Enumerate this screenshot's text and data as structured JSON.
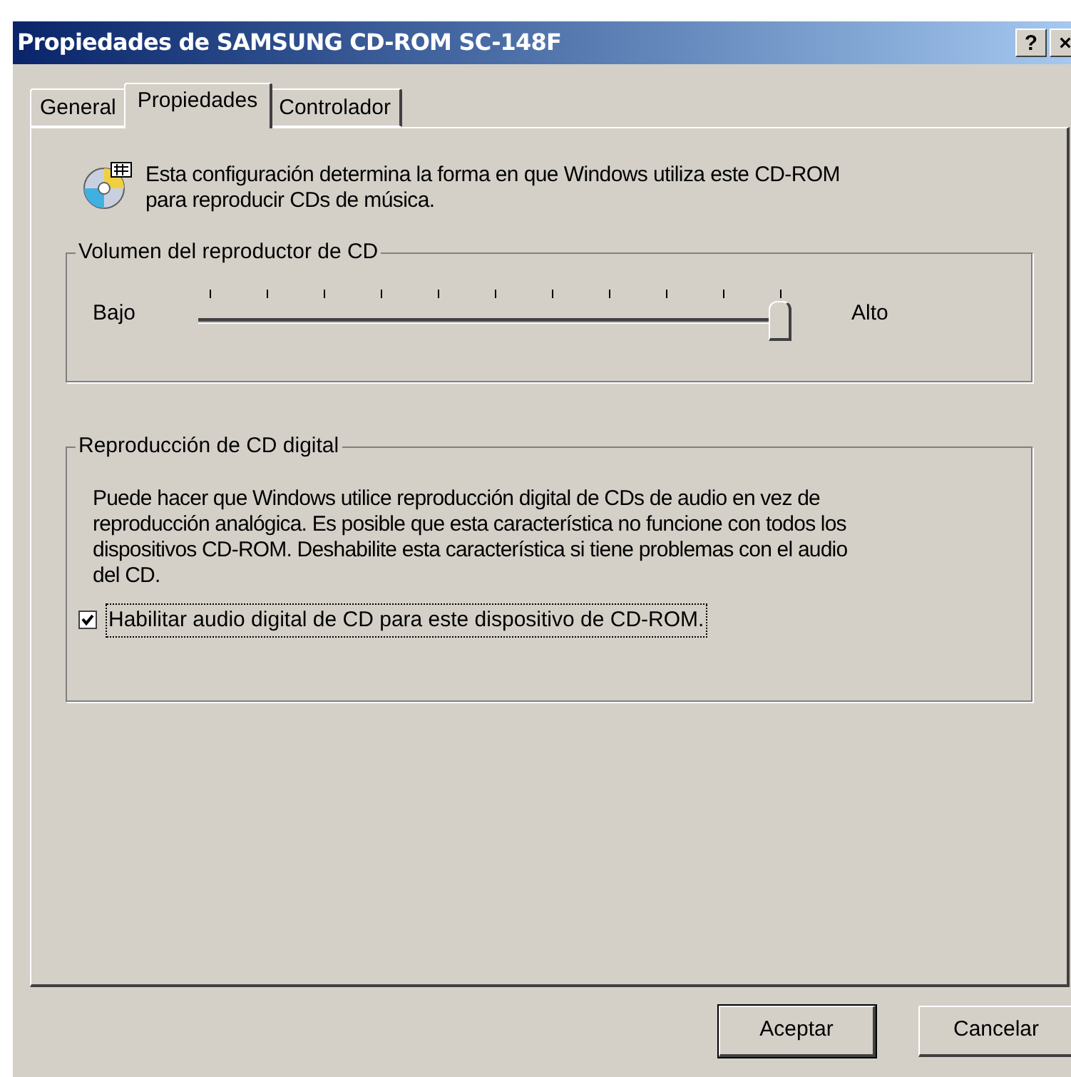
{
  "window": {
    "title": "Propiedades de SAMSUNG CD-ROM SC-148F",
    "title_buttons": [
      "?",
      "×"
    ]
  },
  "tabs": [
    {
      "label": "General",
      "selected": false
    },
    {
      "label": "Propiedades",
      "selected": true
    },
    {
      "label": "Controlador",
      "selected": false
    }
  ],
  "intro": "Esta configuración determina la forma en que Windows utiliza este CD-ROM para reproducir CDs de música.",
  "volume_group": {
    "title": "Volumen del reproductor de CD",
    "low_label": "Bajo",
    "high_label": "Alto",
    "level": 1.0
  },
  "digital_group": {
    "title": "Reproducción de CD digital",
    "description": "Puede hacer que Windows utilice reproducción digital de CDs de audio en vez de reproducción analógica. Es posible que esta característica no funcione con todos los dispositivos CD-ROM. Deshabilite esta característica si tiene problemas con el audio del CD.",
    "checkbox": {
      "label": "Habilitar audio digital de CD para este dispositivo de CD-ROM.",
      "checked": true
    }
  },
  "buttons": [
    {
      "label": "Aceptar",
      "default": true
    },
    {
      "label": "Cancelar",
      "default": false
    }
  ]
}
